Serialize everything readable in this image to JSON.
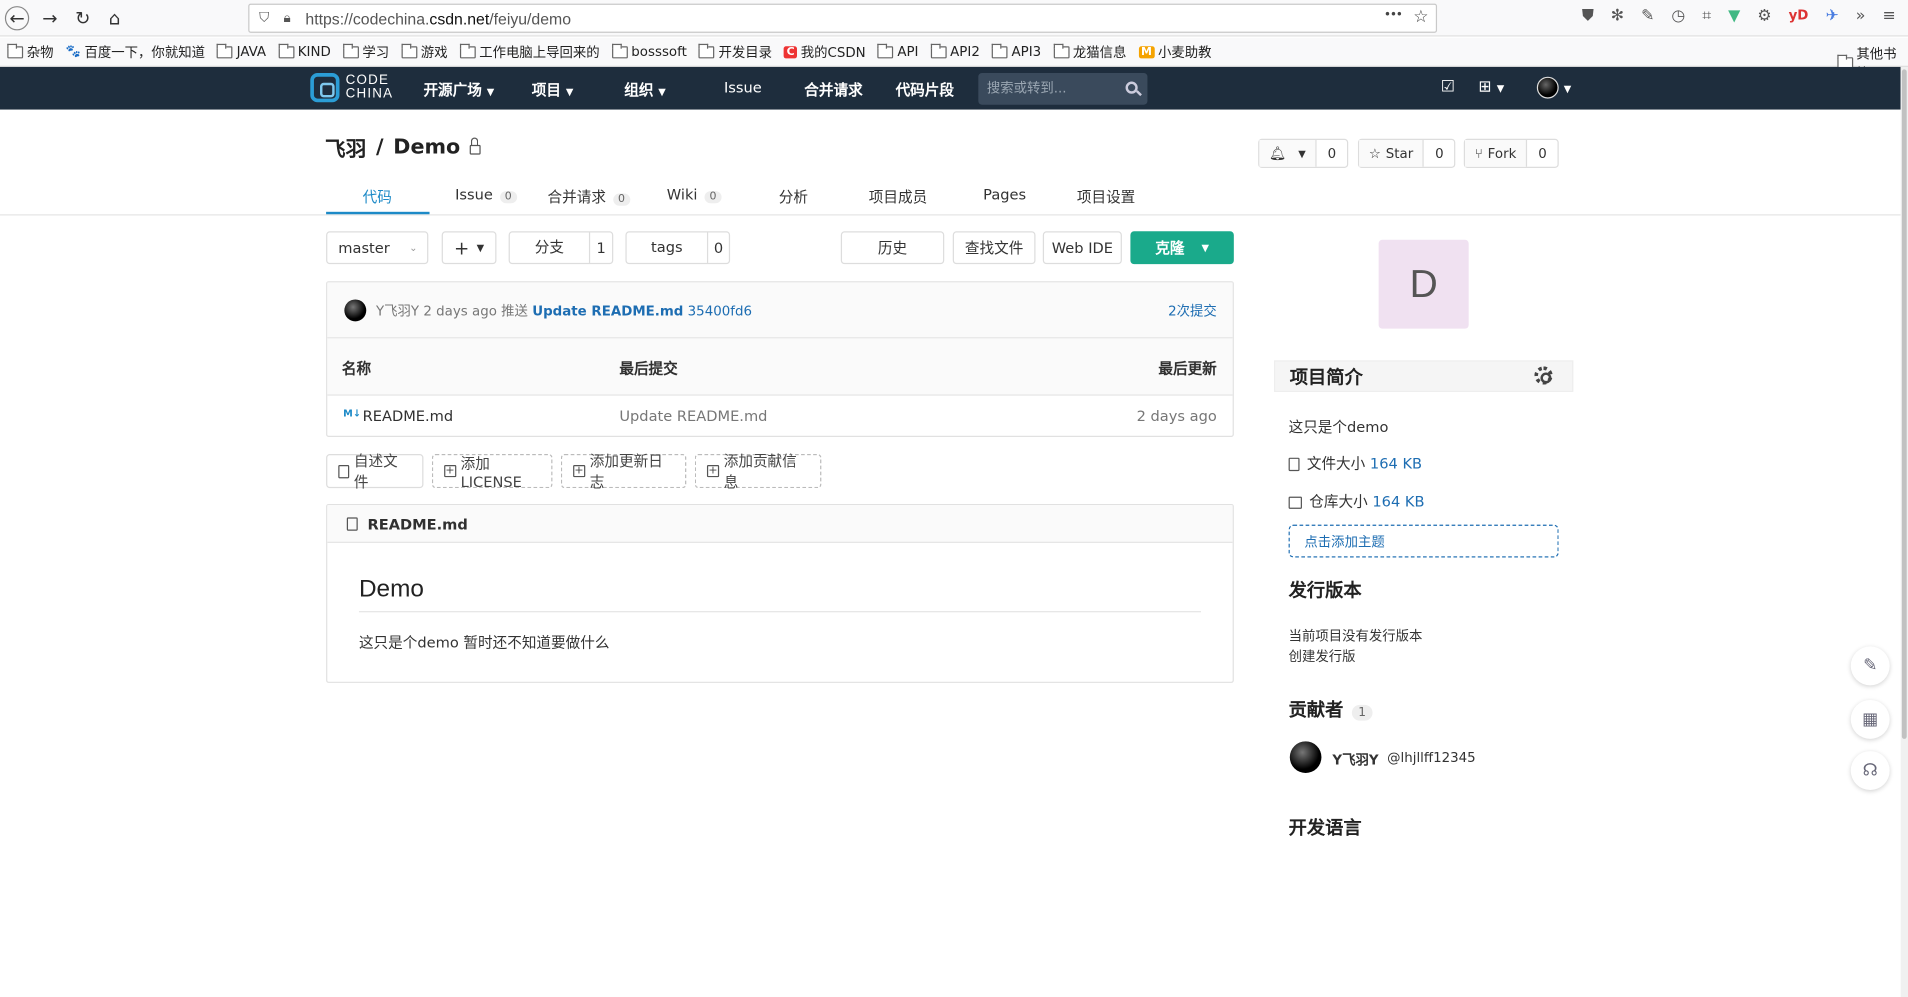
{
  "browser": {
    "url_prefix": "https://codechina.",
    "url_domain": "csdn.net",
    "url_path": "/feiyu/demo",
    "more": "•••",
    "bookmarks": [
      "杂物",
      "百度一下，你就知道",
      "JAVA",
      "KIND",
      "学习",
      "游戏",
      "工作电脑上导回来的",
      "bosssoft",
      "开发目录",
      "我的CSDN",
      "API",
      "API2",
      "API3",
      "龙猫信息",
      "小麦助教"
    ],
    "other_bookmarks": "其他书签",
    "ext_yd": "yD"
  },
  "header": {
    "logo_line1": "CODE",
    "logo_line2": "CHINA",
    "nav": [
      "开源广场",
      "项目",
      "组织",
      "Issue",
      "合并请求",
      "代码片段"
    ],
    "search_placeholder": "搜索或转到..."
  },
  "project": {
    "owner": "飞羽",
    "separator": "/",
    "name": "Demo",
    "watch_count": "0",
    "star_label": "Star",
    "star_count": "0",
    "fork_label": "Fork",
    "fork_count": "0"
  },
  "tabs": [
    {
      "label": "代码",
      "count": ""
    },
    {
      "label": "Issue",
      "count": "0"
    },
    {
      "label": "合并请求",
      "count": "0"
    },
    {
      "label": "Wiki",
      "count": "0"
    },
    {
      "label": "分析",
      "count": ""
    },
    {
      "label": "项目成员",
      "count": ""
    },
    {
      "label": "Pages",
      "count": ""
    },
    {
      "label": "项目设置",
      "count": ""
    }
  ],
  "toolbar": {
    "branch": "master",
    "add": "+",
    "branches_label": "分支",
    "branches_count": "1",
    "tags_label": "tags",
    "tags_count": "0",
    "history": "历史",
    "find_file": "查找文件",
    "web_ide": "Web IDE",
    "clone": "克隆"
  },
  "commit": {
    "author": "Y飞羽Y",
    "time": "2 days ago",
    "action": "推送",
    "message": "Update README.md",
    "sha": "35400fd6",
    "total": "2次提交"
  },
  "files": {
    "headers": [
      "名称",
      "最后提交",
      "最后更新"
    ],
    "rows": [
      {
        "name": "README.md",
        "commit": "Update README.md",
        "updated": "2 days ago"
      }
    ]
  },
  "quick_actions": [
    "自述文件",
    "添加LICENSE",
    "添加更新日志",
    "添加贡献信息"
  ],
  "readme": {
    "filename": "README.md",
    "heading": "Demo",
    "body": "这只是个demo 暂时还不知道要做什么"
  },
  "sidebar": {
    "avatar_letter": "D",
    "intro_title": "项目简介",
    "description": "这只是个demo",
    "file_size_label": "文件大小",
    "file_size": "164 KB",
    "repo_size_label": "仓库大小",
    "repo_size": "164 KB",
    "add_topic": "点击添加主题",
    "release_title": "发行版本",
    "no_release": "当前项目没有发行版本",
    "create_release": "创建发行版",
    "contributors_title": "贡献者",
    "contributors_count": "1",
    "contributor_name": "Y飞羽Y",
    "contributor_handle": "@lhjllff12345",
    "languages_title": "开发语言"
  },
  "colors": {
    "header_bg": "#1e2d3d",
    "accent": "#1d8ac7",
    "clone_btn": "#1aaa8b",
    "link": "#1d6db2"
  }
}
